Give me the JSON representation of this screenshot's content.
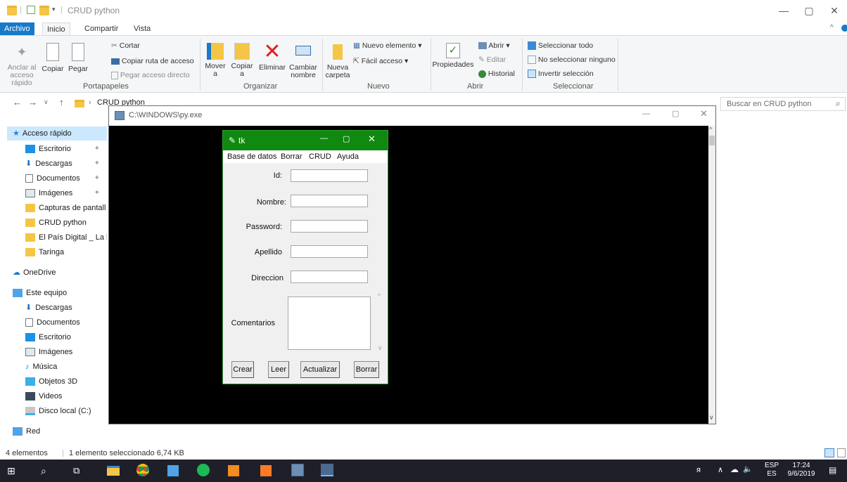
{
  "explorer": {
    "title": "CRUD python",
    "tabs": [
      "Archivo",
      "Inicio",
      "Compartir",
      "Vista"
    ],
    "ribbon": {
      "clipboard": {
        "pin_label": "Anclar al acceso rápido",
        "copy_label": "Copiar",
        "paste_label": "Pegar",
        "cut_label": "Cortar",
        "copy_path_label": "Copiar ruta de acceso",
        "paste_shortcut_label": "Pegar acceso directo",
        "group_label": "Portapapeles"
      },
      "organize": {
        "move_label": "Mover a",
        "copy_to_label": "Copiar a",
        "delete_label": "Eliminar",
        "rename_label": "Cambiar nombre",
        "group_label": "Organizar"
      },
      "new": {
        "new_folder_label": "Nueva carpeta",
        "new_item_label": "Nuevo elemento",
        "easy_access_label": "Fácil acceso",
        "group_label": "Nuevo"
      },
      "open": {
        "properties_label": "Propiedades",
        "open_label": "Abrir",
        "edit_label": "Editar",
        "history_label": "Historial",
        "group_label": "Abrir"
      },
      "select": {
        "select_all_label": "Seleccionar todo",
        "select_none_label": "No seleccionar ninguno",
        "invert_label": "Invertir selección",
        "group_label": "Seleccionar"
      }
    },
    "address": {
      "path_label": "CRUD python",
      "search_placeholder": "Buscar en CRUD python"
    },
    "nav": {
      "quick_access": "Acceso rápido",
      "quick_items": [
        "Escritorio",
        "Descargas",
        "Documentos",
        "Imágenes",
        "Capturas de pantall",
        "CRUD python",
        "El País Digital _ La h",
        "Taringa"
      ],
      "onedrive": "OneDrive",
      "this_pc": "Este equipo",
      "pc_items": [
        "Descargas",
        "Documentos",
        "Escritorio",
        "Imágenes",
        "Música",
        "Objetos 3D",
        "Videos",
        "Disco local (C:)"
      ],
      "network": "Red"
    },
    "status": {
      "count": "4 elementos",
      "selection": "1 elemento seleccionado  6,74 KB"
    }
  },
  "console": {
    "title": "C:\\WINDOWS\\py.exe"
  },
  "tk": {
    "title": "tk",
    "menu": [
      "Base de datos",
      "Borrar",
      "CRUD",
      "Ayuda"
    ],
    "fields": {
      "id_label": "Id:",
      "name_label": "Nombre:",
      "password_label": "Password:",
      "surname_label": "Apellido",
      "address_label": "Direccion",
      "comments_label": "Comentarios"
    },
    "buttons": {
      "create": "Crear",
      "read": "Leer",
      "update": "Actualizar",
      "delete": "Borrar"
    }
  },
  "taskbar": {
    "lang_top": "ESP",
    "lang_bottom": "ES",
    "time": "17:24",
    "date": "9/6/2019"
  }
}
